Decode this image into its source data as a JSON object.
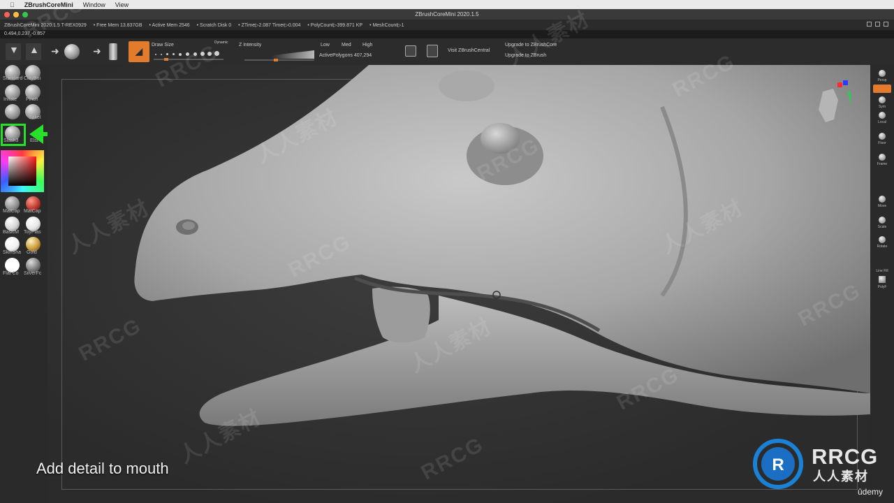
{
  "menubar": {
    "apple": "",
    "app": "ZBrushCoreMini",
    "items": [
      "Window",
      "View"
    ]
  },
  "window": {
    "title": "ZBrushCoreMini 2020.1.5"
  },
  "infobar": {
    "version": "ZBrushCoreMini 2020.1.5 T-REX0929",
    "free_mem": "• Free Mem 13.837GB",
    "active_mem": "• Active Mem 2546",
    "scratch": "• Scratch Disk 0",
    "ztime": "• ZTime▷2.087 Timer▷0.004",
    "polycount": "• PolyCount▷399.871 KP",
    "meshcount": "• MeshCount▷1"
  },
  "coords": "0.494,0.237,-0.857",
  "shelf": {
    "draw_size_label": "Draw Size",
    "dynamic_label": "Dynamic",
    "z_intensity_label": "Z Intensity",
    "low": "Low",
    "med": "Med",
    "high": "High",
    "active_polygons": "ActivePolygons  407,294",
    "visit_central": "Visit ZBrushCentral",
    "upgrade_core": "Upgrade to ZBrushCore",
    "upgrade_zbrush": "Upgrade to ZBrush",
    "draw_size_level": 0.15,
    "z_intensity_level": 0.45
  },
  "brushes": [
    {
      "label": "Standard"
    },
    {
      "label": "ClayBui"
    },
    {
      "label": "Inflate"
    },
    {
      "label": "Pinch"
    },
    {
      "label": ""
    },
    {
      "label": "Sakel"
    },
    {
      "label": "Slash3"
    },
    {
      "label": "Elst"
    }
  ],
  "materials": [
    {
      "label": "MatCap",
      "color": "#9a9a9a"
    },
    {
      "label": "MatCap",
      "color": "#b8332b"
    },
    {
      "label": "BasicM",
      "color": "#d4d4d4"
    },
    {
      "label": "ToyPlas",
      "color": "#e6e6e6"
    },
    {
      "label": "SkinSha",
      "color": "#f2f2f2"
    },
    {
      "label": "Gold",
      "color": "#c99a3a"
    },
    {
      "label": "Flat Co",
      "color": "#ffffff"
    },
    {
      "label": "SilverFc",
      "color": "#7d7d7d"
    }
  ],
  "right_tray": [
    "Persp",
    "Sym",
    "Local",
    "Floor",
    "Frame",
    "Move",
    "Scale",
    "Rotate",
    "Line Fill",
    "PolyF"
  ],
  "caption": "Add detail to mouth",
  "watermarks": {
    "rrcg": "RRCG",
    "cn": "人人素材"
  },
  "logo": {
    "text": "RRCG",
    "sub": "人人素材"
  },
  "udemy": "ûdemy",
  "colors": {
    "accent": "#e37b2d",
    "highlight": "#27e02c"
  }
}
